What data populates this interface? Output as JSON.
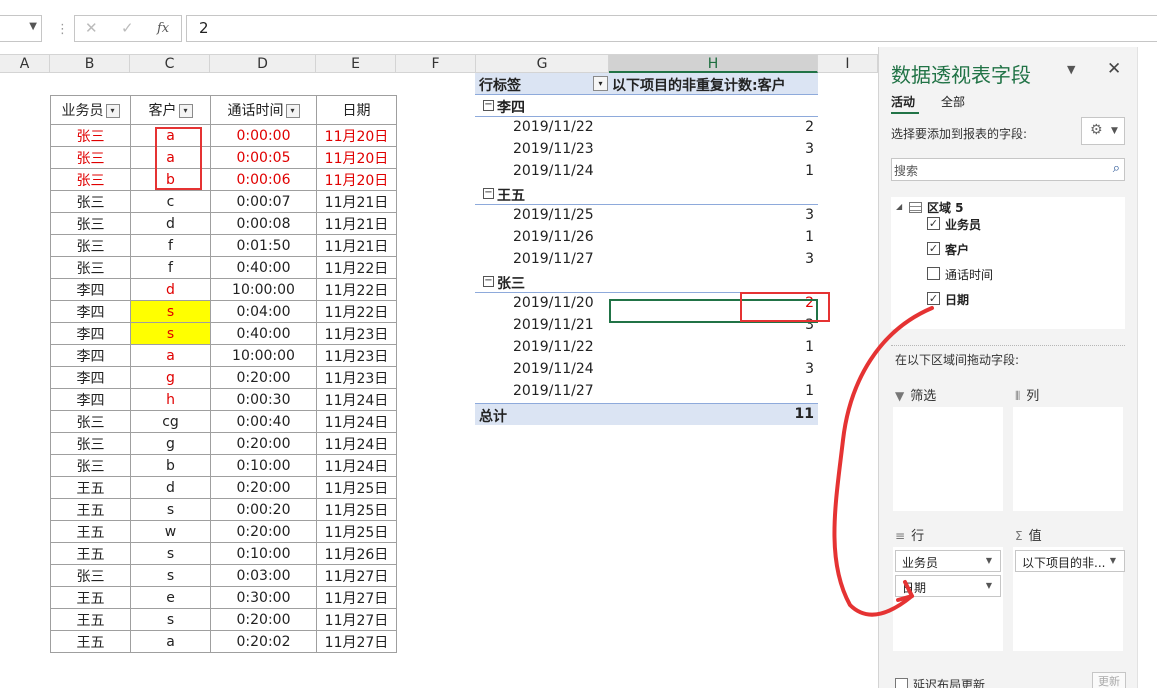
{
  "formula_bar": {
    "cancel_icon": "✕",
    "enter_icon": "✓",
    "fx_label": "fx",
    "value": "2"
  },
  "columns": [
    "A",
    "B",
    "C",
    "D",
    "E",
    "F",
    "G",
    "H",
    "I"
  ],
  "source_table": {
    "headers": [
      "业务员",
      "客户",
      "通话时间",
      "日期"
    ],
    "filter_icon": "▾",
    "rows": [
      {
        "cells": [
          "张三",
          "a",
          "0:00:00",
          "11月20日"
        ],
        "red": [
          0,
          1,
          2,
          3
        ],
        "yellow": []
      },
      {
        "cells": [
          "张三",
          "a",
          "0:00:05",
          "11月20日"
        ],
        "red": [
          0,
          1,
          2,
          3
        ],
        "yellow": []
      },
      {
        "cells": [
          "张三",
          "b",
          "0:00:06",
          "11月20日"
        ],
        "red": [
          0,
          1,
          2,
          3
        ],
        "yellow": []
      },
      {
        "cells": [
          "张三",
          "c",
          "0:00:07",
          "11月21日"
        ],
        "red": [],
        "yellow": []
      },
      {
        "cells": [
          "张三",
          "d",
          "0:00:08",
          "11月21日"
        ],
        "red": [],
        "yellow": []
      },
      {
        "cells": [
          "张三",
          "f",
          "0:01:50",
          "11月21日"
        ],
        "red": [],
        "yellow": []
      },
      {
        "cells": [
          "张三",
          "f",
          "0:40:00",
          "11月22日"
        ],
        "red": [],
        "yellow": []
      },
      {
        "cells": [
          "李四",
          "d",
          "10:00:00",
          "11月22日"
        ],
        "red": [
          1
        ],
        "yellow": []
      },
      {
        "cells": [
          "李四",
          "s",
          "0:04:00",
          "11月22日"
        ],
        "red": [
          1
        ],
        "yellow": [
          1
        ]
      },
      {
        "cells": [
          "李四",
          "s",
          "0:40:00",
          "11月23日"
        ],
        "red": [
          1
        ],
        "yellow": [
          1
        ]
      },
      {
        "cells": [
          "李四",
          "a",
          "10:00:00",
          "11月23日"
        ],
        "red": [
          1
        ],
        "yellow": []
      },
      {
        "cells": [
          "李四",
          "g",
          "0:20:00",
          "11月23日"
        ],
        "red": [
          1
        ],
        "yellow": []
      },
      {
        "cells": [
          "李四",
          "h",
          "0:00:30",
          "11月24日"
        ],
        "red": [
          1
        ],
        "yellow": []
      },
      {
        "cells": [
          "张三",
          "cg",
          "0:00:40",
          "11月24日"
        ],
        "red": [],
        "yellow": []
      },
      {
        "cells": [
          "张三",
          "g",
          "0:20:00",
          "11月24日"
        ],
        "red": [],
        "yellow": []
      },
      {
        "cells": [
          "张三",
          "b",
          "0:10:00",
          "11月24日"
        ],
        "red": [],
        "yellow": []
      },
      {
        "cells": [
          "王五",
          "d",
          "0:20:00",
          "11月25日"
        ],
        "red": [],
        "yellow": []
      },
      {
        "cells": [
          "王五",
          "s",
          "0:00:20",
          "11月25日"
        ],
        "red": [],
        "yellow": []
      },
      {
        "cells": [
          "王五",
          "w",
          "0:20:00",
          "11月25日"
        ],
        "red": [],
        "yellow": []
      },
      {
        "cells": [
          "王五",
          "s",
          "0:10:00",
          "11月26日"
        ],
        "red": [],
        "yellow": []
      },
      {
        "cells": [
          "张三",
          "s",
          "0:03:00",
          "11月27日"
        ],
        "red": [],
        "yellow": []
      },
      {
        "cells": [
          "王五",
          "e",
          "0:30:00",
          "11月27日"
        ],
        "red": [],
        "yellow": []
      },
      {
        "cells": [
          "王五",
          "s",
          "0:20:00",
          "11月27日"
        ],
        "red": [],
        "yellow": []
      },
      {
        "cells": [
          "王五",
          "a",
          "0:20:02",
          "11月27日"
        ],
        "red": [],
        "yellow": []
      }
    ]
  },
  "pivot": {
    "row_label": "行标签",
    "value_header": "以下项目的非重复计数:客户",
    "collapse_icon": "−",
    "groups": [
      {
        "name": "李四",
        "rows": [
          {
            "date": "2019/11/22",
            "value": "2"
          },
          {
            "date": "2019/11/23",
            "value": "3"
          },
          {
            "date": "2019/11/24",
            "value": "1"
          }
        ]
      },
      {
        "name": "王五",
        "rows": [
          {
            "date": "2019/11/25",
            "value": "3"
          },
          {
            "date": "2019/11/26",
            "value": "1"
          },
          {
            "date": "2019/11/27",
            "value": "3"
          }
        ]
      },
      {
        "name": "张三",
        "rows": [
          {
            "date": "2019/11/20",
            "value": "2",
            "red": true
          },
          {
            "date": "2019/11/21",
            "value": "3"
          },
          {
            "date": "2019/11/22",
            "value": "1"
          },
          {
            "date": "2019/11/24",
            "value": "3"
          },
          {
            "date": "2019/11/27",
            "value": "1"
          }
        ]
      }
    ],
    "total_label": "总计",
    "total_value": "11"
  },
  "field_pane": {
    "title": "数据透视表字段",
    "tab_active": "活动",
    "tab_all": "全部",
    "choose_label": "选择要添加到报表的字段:",
    "search_placeholder": "搜索",
    "area_name": "区域 5",
    "fields": [
      {
        "label": "业务员",
        "checked": true
      },
      {
        "label": "客户",
        "checked": true
      },
      {
        "label": "通话时间",
        "checked": false
      },
      {
        "label": "日期",
        "checked": true
      }
    ],
    "drag_label": "在以下区域间拖动字段:",
    "zone_filter": "筛选",
    "zone_columns": "列",
    "zone_rows": "行",
    "zone_values": "值",
    "row_chips": [
      "业务员",
      "日期"
    ],
    "value_chips": [
      "以下项目的非..."
    ],
    "defer_label": "延迟布局更新",
    "update_button": "更新"
  },
  "colors": {
    "accent": "#217346",
    "annotation": "#e53333",
    "highlight": "#ffff00",
    "pivot_header": "#dbe4f3"
  }
}
